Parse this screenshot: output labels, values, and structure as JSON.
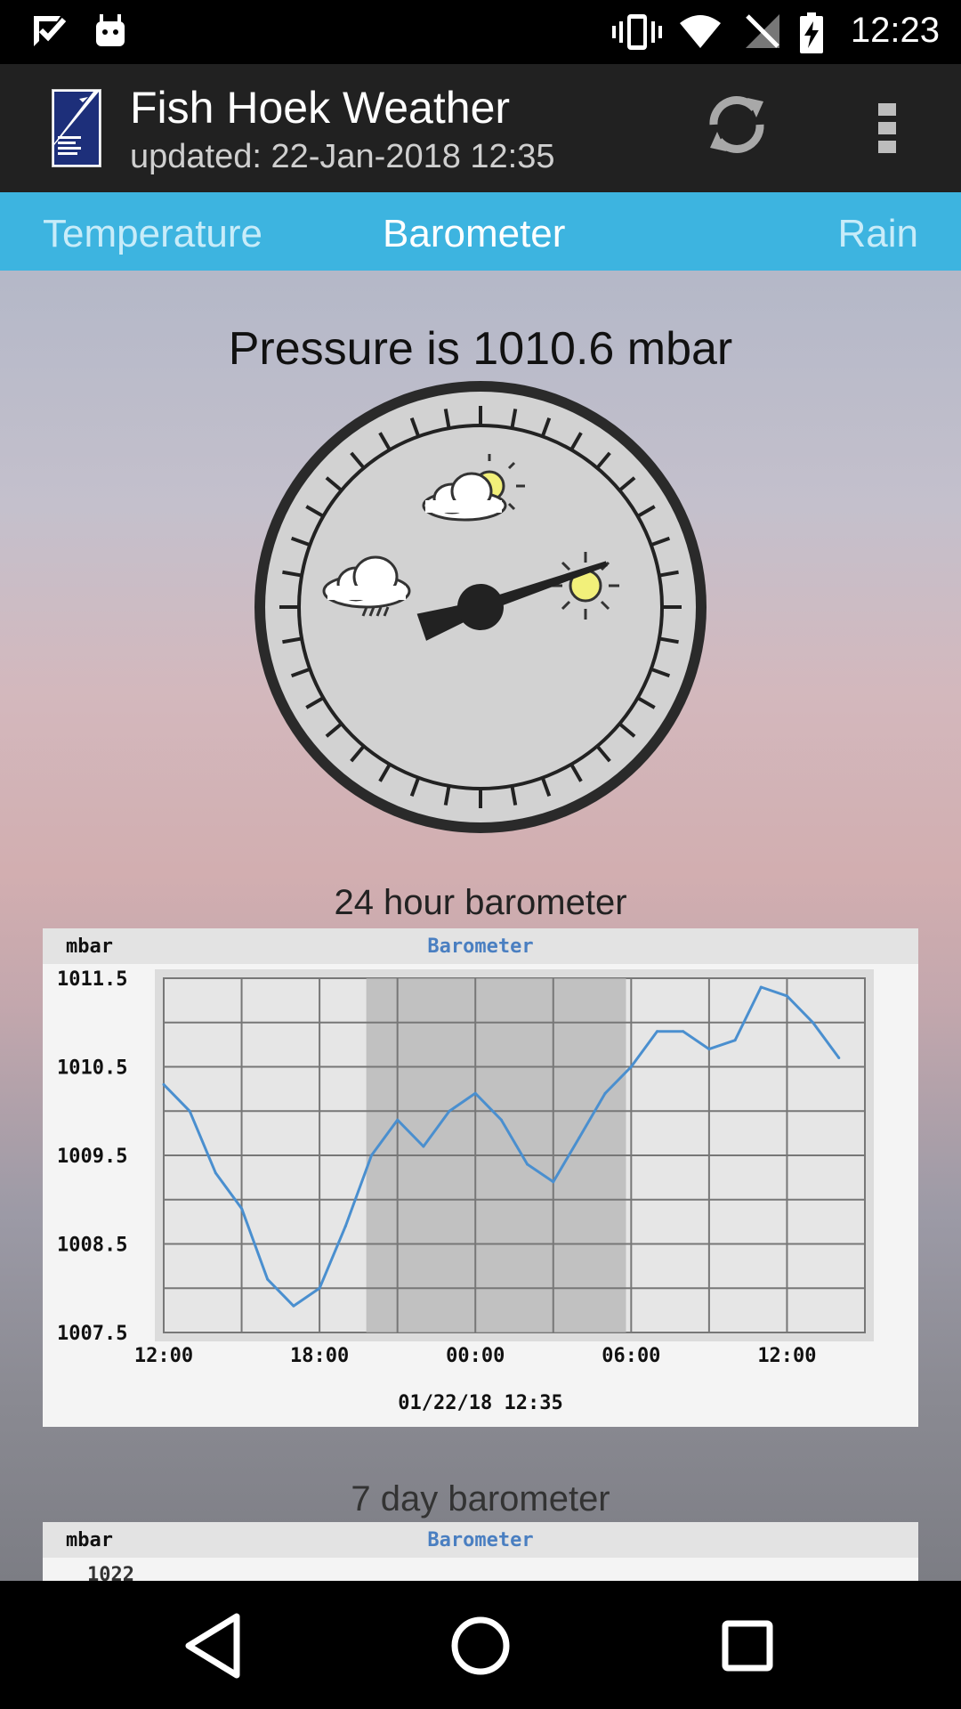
{
  "status": {
    "time": "12:23"
  },
  "app": {
    "title": "Fish Hoek Weather",
    "subtitle": "updated: 22-Jan-2018 12:35",
    "refresh_icon": "refresh-icon",
    "more_icon": "more-vert-icon"
  },
  "tabs": [
    {
      "label": "Temperature",
      "active": false
    },
    {
      "label": "Barometer",
      "active": true
    },
    {
      "label": "Rain",
      "active": false
    }
  ],
  "pressure_text": "Pressure is 1010.6 mbar",
  "gauge": {
    "value": 1010.6,
    "unit": "mbar"
  },
  "chart1_caption": "24 hour barometer",
  "chart2_caption": "7 day barometer",
  "chart_data": [
    {
      "type": "line",
      "title": "Barometer",
      "ylabel": "mbar",
      "xlabel": "01/22/18 12:35",
      "x_tick_labels": [
        "12:00",
        "18:00",
        "00:00",
        "06:00",
        "12:00"
      ],
      "y_tick_labels": [
        "1011.5",
        "1010.5",
        "1009.5",
        "1008.5",
        "1007.5"
      ],
      "ylim": [
        1007.5,
        1011.5
      ],
      "xlim": [
        0,
        27
      ],
      "grid": true,
      "series": [
        {
          "color": "#4a8fcf",
          "x": [
            0,
            1,
            2,
            3,
            4,
            5,
            6,
            7,
            8,
            9,
            10,
            11,
            12,
            13,
            14,
            15,
            16,
            17,
            18,
            19,
            20,
            21,
            22,
            23,
            24,
            25,
            26
          ],
          "y": [
            1010.3,
            1010.0,
            1009.3,
            1008.9,
            1008.1,
            1007.8,
            1008.0,
            1008.7,
            1009.5,
            1009.9,
            1009.6,
            1010.0,
            1010.2,
            1009.9,
            1009.4,
            1009.2,
            1009.7,
            1010.2,
            1010.5,
            1010.9,
            1010.9,
            1010.7,
            1010.8,
            1011.4,
            1011.3,
            1011.0,
            1010.6
          ]
        }
      ]
    },
    {
      "type": "line",
      "title": "Barometer",
      "ylabel": "mbar",
      "y_tick_labels": [
        "1022"
      ]
    }
  ],
  "colors": {
    "tab_bar": "#3db4e0",
    "app_bar": "#212121",
    "series": "#4a8fcf"
  }
}
